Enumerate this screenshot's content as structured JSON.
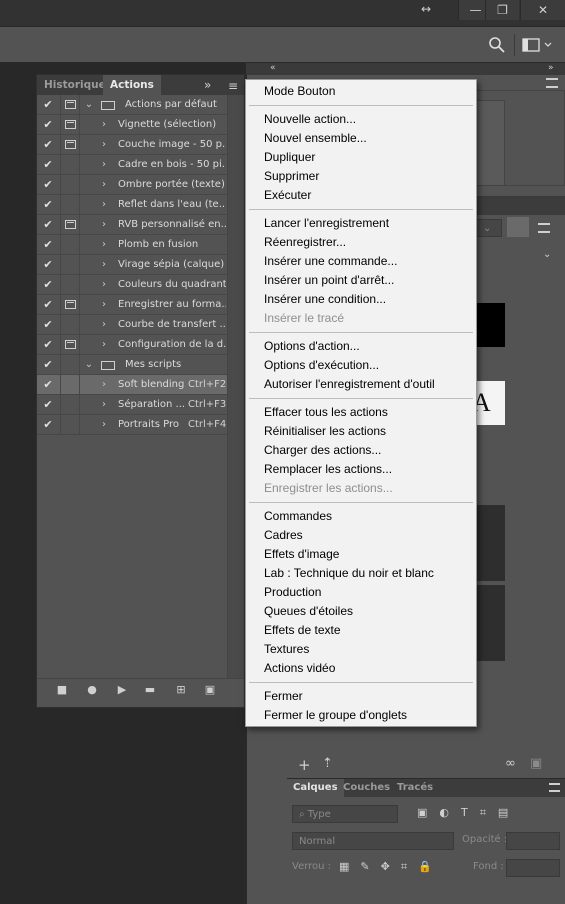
{
  "panel": {
    "tab_history": "Historique",
    "tab_actions": "Actions",
    "tab_expand": "»",
    "menu_glyph": "≡",
    "rows": [
      {
        "label": "Actions par défaut",
        "kind": "set",
        "dialog": true,
        "shortcut": ""
      },
      {
        "label": "Vignette (sélection)",
        "kind": "action",
        "dialog": true,
        "shortcut": ""
      },
      {
        "label": "Couche image - 50 p...",
        "kind": "action",
        "dialog": true,
        "shortcut": ""
      },
      {
        "label": "Cadre en bois - 50 pi...",
        "kind": "action",
        "dialog": false,
        "shortcut": ""
      },
      {
        "label": "Ombre portée (texte)",
        "kind": "action",
        "dialog": false,
        "shortcut": ""
      },
      {
        "label": "Reflet dans l'eau (te...",
        "kind": "action",
        "dialog": false,
        "shortcut": ""
      },
      {
        "label": "RVB personnalisé en...",
        "kind": "action",
        "dialog": true,
        "shortcut": ""
      },
      {
        "label": "Plomb en fusion",
        "kind": "action",
        "dialog": false,
        "shortcut": ""
      },
      {
        "label": "Virage sépia (calque)",
        "kind": "action",
        "dialog": false,
        "shortcut": ""
      },
      {
        "label": "Couleurs du quadrant",
        "kind": "action",
        "dialog": false,
        "shortcut": ""
      },
      {
        "label": "Enregistrer au forma...",
        "kind": "action",
        "dialog": true,
        "shortcut": ""
      },
      {
        "label": "Courbe de transfert ...",
        "kind": "action",
        "dialog": false,
        "shortcut": ""
      },
      {
        "label": "Configuration de la d...",
        "kind": "action",
        "dialog": true,
        "shortcut": ""
      },
      {
        "label": "Mes scripts",
        "kind": "set",
        "dialog": false,
        "shortcut": ""
      },
      {
        "label": "Soft blending",
        "kind": "action",
        "dialog": false,
        "shortcut": "Ctrl+F2"
      },
      {
        "label": "Séparation ...",
        "kind": "action",
        "dialog": false,
        "shortcut": "Ctrl+F3"
      },
      {
        "label": "Portraits Pro",
        "kind": "action",
        "dialog": false,
        "shortcut": "Ctrl+F4"
      }
    ]
  },
  "menu": {
    "groups": [
      [
        {
          "label": "Mode Bouton",
          "enabled": true
        }
      ],
      [
        {
          "label": "Nouvelle action...",
          "enabled": true
        },
        {
          "label": "Nouvel ensemble...",
          "enabled": true
        },
        {
          "label": "Dupliquer",
          "enabled": true
        },
        {
          "label": "Supprimer",
          "enabled": true
        },
        {
          "label": "Exécuter",
          "enabled": true
        }
      ],
      [
        {
          "label": "Lancer l'enregistrement",
          "enabled": true
        },
        {
          "label": "Réenregistrer...",
          "enabled": true
        },
        {
          "label": "Insérer une commande...",
          "enabled": true
        },
        {
          "label": "Insérer un point d'arrêt...",
          "enabled": true
        },
        {
          "label": "Insérer une condition...",
          "enabled": true
        },
        {
          "label": "Insérer le tracé",
          "enabled": false
        }
      ],
      [
        {
          "label": "Options d'action...",
          "enabled": true
        },
        {
          "label": "Options d'exécution...",
          "enabled": true
        },
        {
          "label": "Autoriser l'enregistrement d'outil",
          "enabled": true
        }
      ],
      [
        {
          "label": "Effacer tous les actions",
          "enabled": true
        },
        {
          "label": "Réinitialiser les actions",
          "enabled": true
        },
        {
          "label": "Charger des actions...",
          "enabled": true
        },
        {
          "label": "Remplacer les actions...",
          "enabled": true
        },
        {
          "label": "Enregistrer les actions...",
          "enabled": false
        }
      ],
      [
        {
          "label": "Commandes",
          "enabled": true
        },
        {
          "label": "Cadres",
          "enabled": true
        },
        {
          "label": "Effets d'image",
          "enabled": true
        },
        {
          "label": "Lab : Technique du noir et blanc",
          "enabled": true
        },
        {
          "label": "Production",
          "enabled": true
        },
        {
          "label": "Queues d'étoiles",
          "enabled": true
        },
        {
          "label": "Effets de texte",
          "enabled": true
        },
        {
          "label": "Textures",
          "enabled": true
        },
        {
          "label": "Actions vidéo",
          "enabled": true
        }
      ],
      [
        {
          "label": "Fermer",
          "enabled": true
        },
        {
          "label": "Fermer le groupe d'onglets",
          "enabled": true
        }
      ]
    ]
  },
  "layers": {
    "tabs": [
      "Calques",
      "Couches",
      "Tracés"
    ],
    "filter_placeholder": "Type",
    "blend_mode": "Normal",
    "opacity_label": "Opacité :",
    "lock_label": "Verrou :",
    "fill_label": "Fond :"
  },
  "window": {
    "resize_glyph": "↔",
    "minimize_glyph": "—",
    "restore_glyph": "❐",
    "close_glyph": "✕"
  }
}
